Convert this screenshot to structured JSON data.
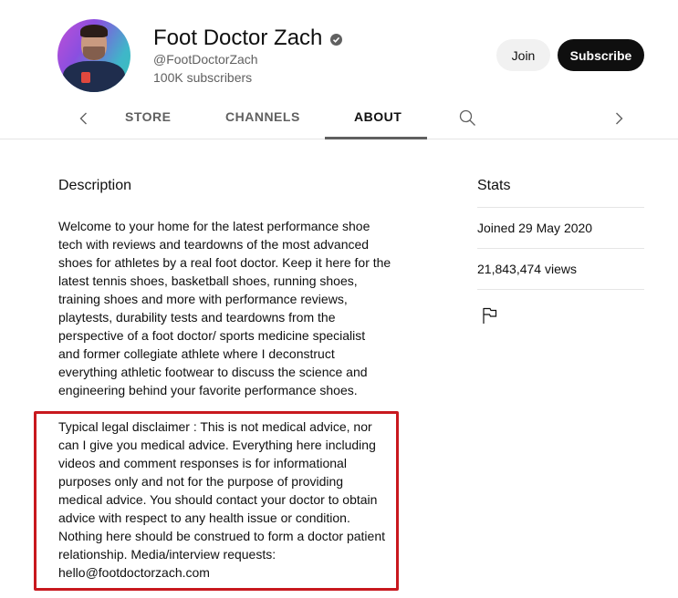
{
  "channel": {
    "name": "Foot Doctor Zach",
    "verified": true,
    "handle": "@FootDoctorZach",
    "subscribers": "100K subscribers",
    "avatar_icon": "channel-avatar"
  },
  "actions": {
    "join_label": "Join",
    "subscribe_label": "Subscribe"
  },
  "tabs": {
    "items": [
      {
        "label": "STORE",
        "active": false
      },
      {
        "label": "CHANNELS",
        "active": false
      },
      {
        "label": "ABOUT",
        "active": true
      }
    ],
    "left_arrow_icon": "chevron-left-icon",
    "right_arrow_icon": "chevron-right-icon",
    "search_icon": "search-icon"
  },
  "description": {
    "title": "Description",
    "text": "Welcome to your home for the latest performance shoe\ntech with reviews and teardowns of the most advanced\nshoes for athletes by a real foot doctor. Keep it here for the\nlatest tennis shoes, basketball shoes, running shoes,\ntraining shoes and more with performance reviews,\nplaytests, durability tests and teardowns from the\nperspective of a foot doctor/ sports medicine specialist\nand former collegiate athlete where I deconstruct\neverything athletic footwear to discuss the science and\nengineering behind your favorite  performance shoes.",
    "disclaimer": "Typical legal disclaimer : This is not medical advice, nor\ncan I give you medical advice. Everything here including\nvideos and comment responses is for informational\npurposes only and not for the purpose of providing\nmedical advice. You should contact your doctor to obtain\nadvice with respect to any health issue or condition.\nNothing here should be construed to form a doctor patient\nrelationship. Media/interview requests:\nhello@footdoctorzach.com",
    "highlight_color": "#c8181e"
  },
  "stats": {
    "title": "Stats",
    "joined": "Joined 29 May 2020",
    "views": "21,843,474 views",
    "report_icon": "flag-icon"
  }
}
